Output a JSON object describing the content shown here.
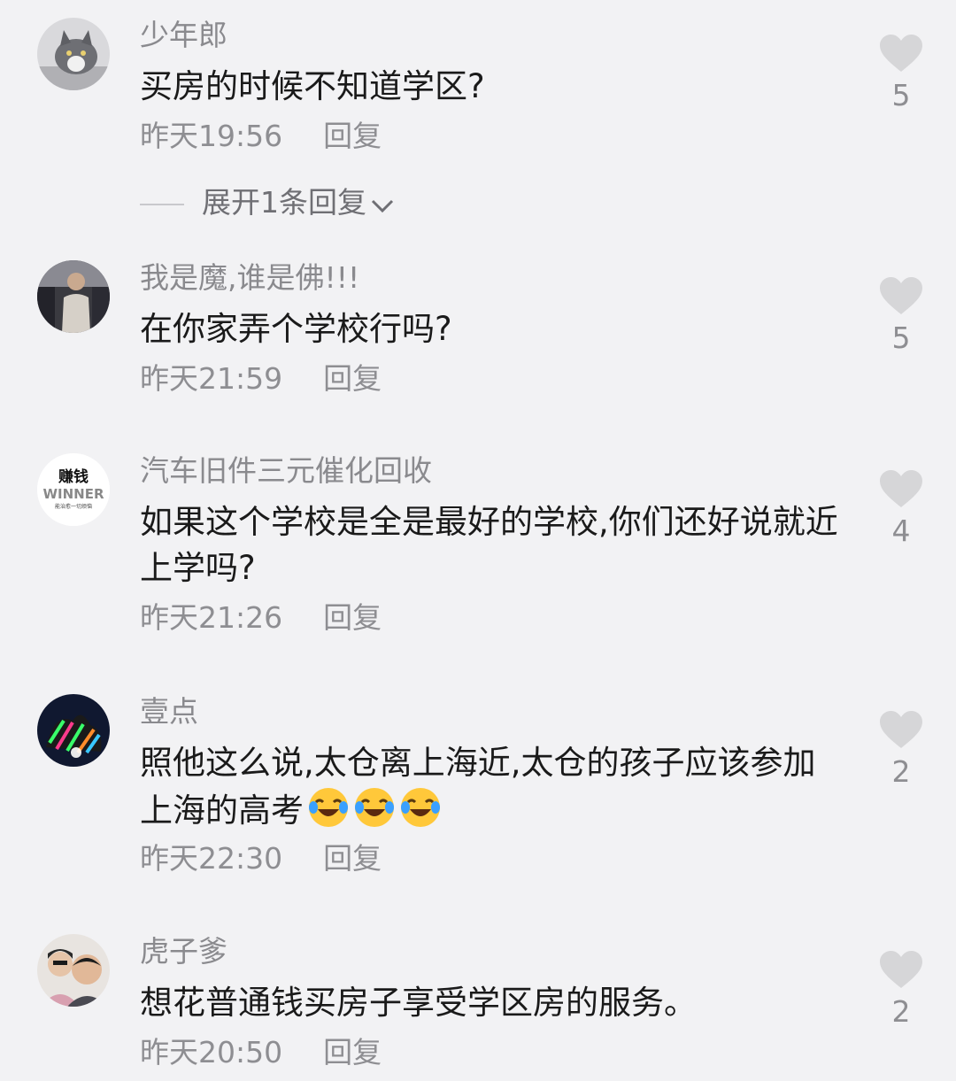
{
  "comments": [
    {
      "username": "少年郎",
      "text": "买房的时候不知道学区?",
      "time": "昨天19:56",
      "reply_label": "回复",
      "likes": "5",
      "avatar_icon": "cat-avatar"
    },
    {
      "username": "我是魔,谁是佛!!!",
      "text": "在你家弄个学校行吗?",
      "time": "昨天21:59",
      "reply_label": "回复",
      "likes": "5",
      "avatar_icon": "person-avatar"
    },
    {
      "username": "汽车旧件三元催化回收",
      "text": "如果这个学校是全是最好的学校,你们还好说就近上学吗?",
      "time": "昨天21:26",
      "reply_label": "回复",
      "likes": "4",
      "avatar_icon": "winner-logo-avatar",
      "avatar_text_top": "赚钱",
      "avatar_text_main": "WINNER",
      "avatar_text_small": "能治愈一切烦恼"
    },
    {
      "username": "壹点",
      "text": "照他这么说,太仓离上海近,太仓的孩子应该参加上海的高考",
      "time": "昨天22:30",
      "reply_label": "回复",
      "likes": "2",
      "avatar_icon": "zebra-avatar",
      "emoji_name": "laughing-crying-emoji",
      "emoji_count": 3
    },
    {
      "username": "虎子爹",
      "text": "想花普通钱买房子享受学区房的服务。",
      "time": "昨天20:50",
      "reply_label": "回复",
      "likes": "2",
      "avatar_icon": "couple-avatar"
    }
  ],
  "expand_replies": {
    "label": "展开1条回复",
    "icon": "chevron-down-icon"
  },
  "colors": {
    "background": "#f2f2f4",
    "username": "#8a8a8e",
    "text": "#1a1a1a",
    "meta": "#8e8e92",
    "heart": "#d6d6d8"
  }
}
